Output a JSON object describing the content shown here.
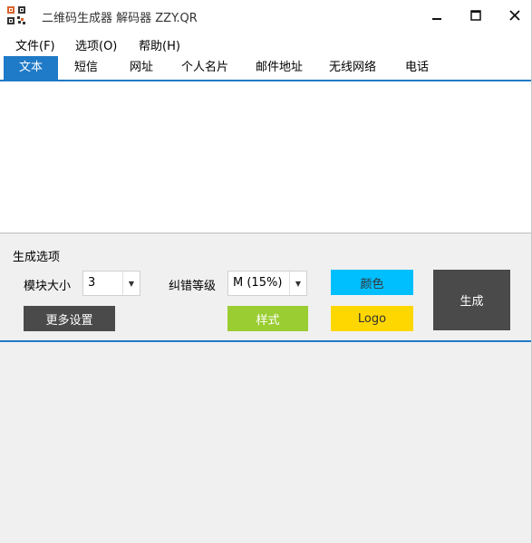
{
  "window": {
    "title": "二维码生成器 解码器 ZZY.QR",
    "icon": "qr-app-icon",
    "controls": {
      "minimize": "—",
      "maximize": "☐",
      "close": "✕"
    }
  },
  "menu": [
    {
      "label": "文件(F)"
    },
    {
      "label": "选项(O)"
    },
    {
      "label": "帮助(H)"
    }
  ],
  "tabs": [
    {
      "label": "文本",
      "active": true
    },
    {
      "label": "短信"
    },
    {
      "label": "网址"
    },
    {
      "label": "个人名片"
    },
    {
      "label": "邮件地址"
    },
    {
      "label": "无线网络"
    },
    {
      "label": "电话"
    }
  ],
  "text_input": {
    "value": ""
  },
  "options": {
    "group_title": "生成选项",
    "module_size_label": "模块大小",
    "module_size_value": "3",
    "ecc_label": "纠错等级",
    "ecc_value": "M (15%)",
    "more_settings": "更多设置",
    "color": "颜色",
    "style": "样式",
    "logo": "Logo",
    "generate": "生成"
  },
  "colors": {
    "accent": "#1f7ac7",
    "dark_button": "#4a4a4a",
    "color_button": "#00bfff",
    "style_button": "#9acd32",
    "logo_button": "#ffd700"
  }
}
